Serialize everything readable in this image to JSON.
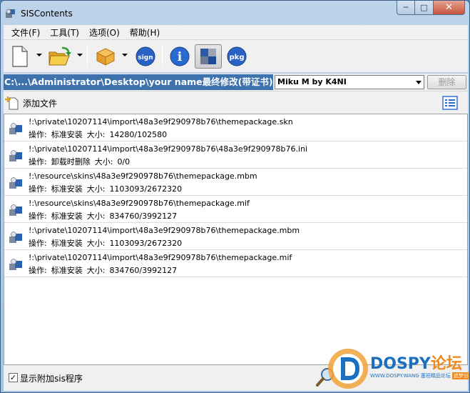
{
  "window": {
    "title": "SISContents",
    "controls": {
      "minimize": "─",
      "maximize": "□",
      "close": "✕"
    }
  },
  "menu": {
    "items": [
      {
        "label": "文件(F)"
      },
      {
        "label": "工具(T)"
      },
      {
        "label": "选项(O)"
      },
      {
        "label": "帮助(H)"
      }
    ]
  },
  "toolbar": {
    "buttons": [
      {
        "icon": "new-file-icon"
      },
      {
        "icon": "open-folder-icon"
      },
      {
        "icon": "package-box-icon"
      },
      {
        "icon": "sign-icon",
        "label": "sign"
      },
      {
        "icon": "info-icon",
        "label": "i"
      },
      {
        "icon": "contents-view-icon"
      },
      {
        "icon": "pkg-icon",
        "label": "pkg"
      }
    ]
  },
  "pathbar": {
    "path": "C:\\...\\Administrator\\Desktop\\your name最终修改(带证书).sis",
    "selected": "Miku M by K4NI",
    "delete_label": "删除"
  },
  "addbar": {
    "add_label": "添加文件"
  },
  "files": [
    {
      "path": "!:\\private\\10207114\\import\\48a3e9f290978b76\\themepackage.skn",
      "op_label": "操作:",
      "op": "标准安装",
      "size_label": "大小:",
      "size": "14280/102580"
    },
    {
      "path": "!:\\private\\10207114\\import\\48a3e9f290978b76\\48a3e9f290978b76.ini",
      "op_label": "操作:",
      "op": "卸载时删除",
      "size_label": "大小:",
      "size": "0/0"
    },
    {
      "path": "!:\\resource\\skins\\48a3e9f290978b76\\themepackage.mbm",
      "op_label": "操作:",
      "op": "标准安装",
      "size_label": "大小:",
      "size": "1103093/2672320"
    },
    {
      "path": "!:\\resource\\skins\\48a3e9f290978b76\\themepackage.mif",
      "op_label": "操作:",
      "op": "标准安装",
      "size_label": "大小:",
      "size": "834760/3992127"
    },
    {
      "path": "!:\\private\\10207114\\import\\48a3e9f290978b76\\themepackage.mbm",
      "op_label": "操作:",
      "op": "标准安装",
      "size_label": "大小:",
      "size": "1103093/2672320"
    },
    {
      "path": "!:\\private\\10207114\\import\\48a3e9f290978b76\\themepackage.mif",
      "op_label": "操作:",
      "op": "标准安装",
      "size_label": "大小:",
      "size": "834760/3992127"
    }
  ],
  "status": {
    "checkbox_checked": true,
    "checkbox_mark": "✓",
    "checkbox_label": "显示附加sis程序"
  },
  "watermark": {
    "brand": "DOSPY",
    "brand_cn": "论坛",
    "sub": "WWW.DOSPY.WANG",
    "sub_tag_1": "塞班精品论坛",
    "sub_tag_2": "追梦分享号"
  },
  "colors": {
    "accent": "#3d72ad",
    "window_frame": "#a7c3e0",
    "close_button": "#c6523c"
  }
}
